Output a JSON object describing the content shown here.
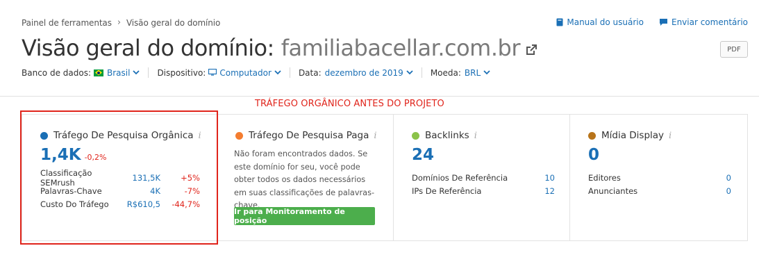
{
  "breadcrumb": {
    "root": "Painel de ferramentas",
    "current": "Visão geral do domínio"
  },
  "top_links": {
    "manual": "Manual do usuário",
    "feedback": "Enviar comentário"
  },
  "title": {
    "label": "Visão geral do domínio:",
    "domain": "familiabacellar.com.br"
  },
  "pdf_label": "PDF",
  "filters": {
    "database_label": "Banco de dados:",
    "database_value": "Brasil",
    "device_label": "Dispositivo:",
    "device_value": "Computador",
    "date_label": "Data:",
    "date_value": "dezembro de 2019",
    "currency_label": "Moeda:",
    "currency_value": "BRL"
  },
  "annotation": "TRÁFEGO ORGÂNICO ANTES DO PROJETO",
  "cards": {
    "organic": {
      "title": "Tráfego De Pesquisa Orgânica",
      "value": "1,4K",
      "change": "-0,2%",
      "rows": [
        {
          "label": "Classificação SEMrush",
          "value": "131,5K",
          "change": "+5%"
        },
        {
          "label": "Palavras-Chave",
          "value": "4K",
          "change": "-7%"
        },
        {
          "label": "Custo Do Tráfego",
          "value": "R$610,5",
          "change": "-44,7%"
        }
      ]
    },
    "paid": {
      "title": "Tráfego De Pesquisa Paga",
      "message": "Não foram encontrados dados. Se este domínio for seu, você pode obter todos os dados necessários em suas classificações de palavras-chave.",
      "button": "Ir para Monitoramento de posição"
    },
    "backlinks": {
      "title": "Backlinks",
      "value": "24",
      "rows": [
        {
          "label": "Domínios De Referência",
          "value": "10"
        },
        {
          "label": "IPs De Referência",
          "value": "12"
        }
      ]
    },
    "display": {
      "title": "Mídia Display",
      "value": "0",
      "rows": [
        {
          "label": "Editores",
          "value": "0"
        },
        {
          "label": "Anunciantes",
          "value": "0"
        }
      ]
    }
  },
  "colors": {
    "organic_dot": "#1a6fb5",
    "paid_dot": "#f47d30",
    "backlinks_dot": "#8bc34a",
    "display_dot": "#b8741a",
    "link": "#1a6fb5",
    "negative": "#e0241b",
    "button": "#4cae4c"
  }
}
